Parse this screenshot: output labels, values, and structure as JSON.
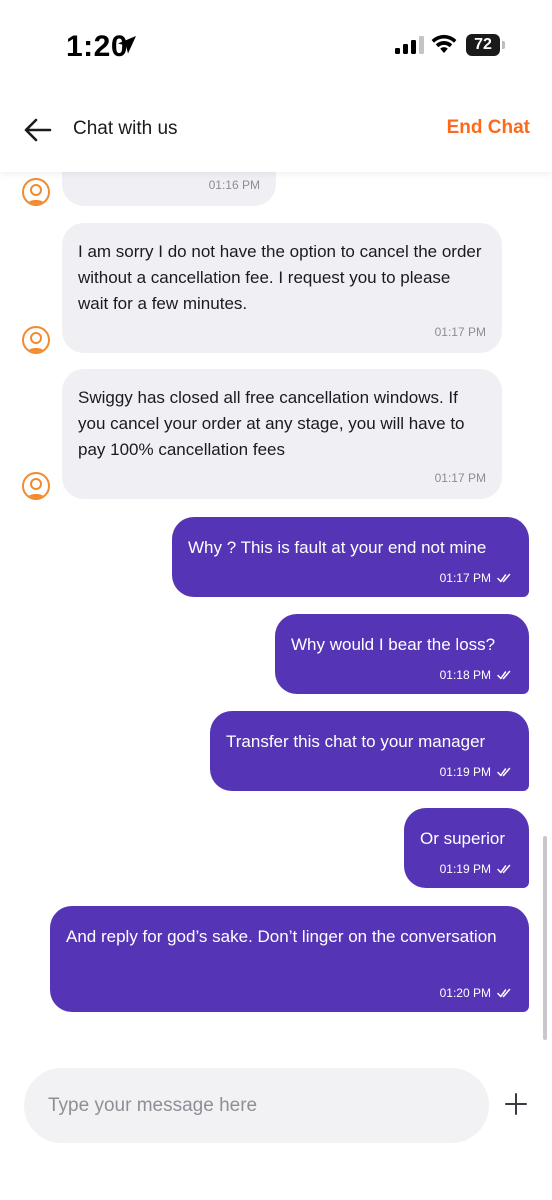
{
  "status_bar": {
    "time": "1:20",
    "battery": "72"
  },
  "header": {
    "title": "Chat with us",
    "end_chat_label": "End Chat"
  },
  "colors": {
    "accent_orange": "#fc6a1c",
    "user_bubble": "#5535b5",
    "agent_bubble": "#f0f0f4"
  },
  "messages": [
    {
      "sender": "agent",
      "text": "",
      "time": "01:16 PM"
    },
    {
      "sender": "agent",
      "text": "I am sorry I do not have the option to cancel the order without a cancellation fee. I request you to please wait for a few minutes.",
      "time": "01:17 PM"
    },
    {
      "sender": "agent",
      "text": "Swiggy has closed all free cancellation windows. If you cancel your order at any stage, you will have to pay 100% cancellation fees",
      "time": "01:17 PM"
    },
    {
      "sender": "user",
      "text": "Why ? This is fault at your end not mine",
      "time": "01:17 PM",
      "status_icon": "double-check-icon"
    },
    {
      "sender": "user",
      "text": "Why would I bear the loss?",
      "time": "01:18 PM",
      "status_icon": "double-check-icon"
    },
    {
      "sender": "user",
      "text": "Transfer this chat to your manager",
      "time": "01:19 PM",
      "status_icon": "double-check-icon"
    },
    {
      "sender": "user",
      "text": "Or superior",
      "time": "01:19 PM",
      "status_icon": "double-check-icon"
    },
    {
      "sender": "user",
      "text": "And reply for god’s sake. Don’t linger on the conversation",
      "time": "01:20 PM",
      "status_icon": "double-check-icon"
    }
  ],
  "composer": {
    "placeholder": "Type your message here",
    "value": ""
  },
  "icons": {
    "back": "arrow-left-icon",
    "add": "plus-icon",
    "agent_avatar": "agent-avatar-icon",
    "location": "location-arrow-icon",
    "signal": "signal-icon",
    "wifi": "wifi-icon",
    "battery": "battery-icon"
  }
}
